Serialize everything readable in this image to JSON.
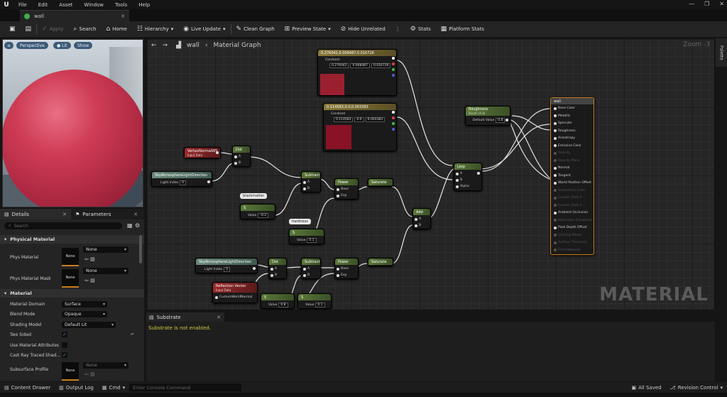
{
  "menu": {
    "items": [
      "File",
      "Edit",
      "Asset",
      "Window",
      "Tools",
      "Help"
    ]
  },
  "tab": {
    "title": "wall"
  },
  "toolbar": {
    "apply": "Apply",
    "search": "Search",
    "home": "Home",
    "hierarchy": "Hierarchy",
    "live_update": "Live Update",
    "clean_graph": "Clean Graph",
    "preview_state": "Preview State",
    "hide_unrelated": "Hide Unrelated",
    "stats": "Stats",
    "platform_stats": "Platform Stats"
  },
  "viewport": {
    "perspective": "Perspective",
    "lit": "Lit",
    "show": "Show"
  },
  "details": {
    "tabs": [
      "Details",
      "Parameters"
    ],
    "search_placeholder": "Search",
    "sections": {
      "physical": "Physical Material",
      "material": "Material"
    },
    "phys_material": {
      "label": "Phys Material",
      "thumb": "None",
      "value": "None"
    },
    "phys_mask": {
      "label": "Phys Material Mask",
      "thumb": "None",
      "value": "None"
    },
    "domain": {
      "label": "Material Domain",
      "value": "Surface"
    },
    "blend": {
      "label": "Blend Mode",
      "value": "Opaque"
    },
    "shading": {
      "label": "Shading Model",
      "value": "Default Lit"
    },
    "two_sided": {
      "label": "Two Sided"
    },
    "use_attr": {
      "label": "Use Material Attributes"
    },
    "cast_ray": {
      "label": "Cast Ray Traced Shad..."
    },
    "subsurface": {
      "label": "Subsurface Profile",
      "thumb": "None",
      "value": "None"
    }
  },
  "graph": {
    "breadcrumb_root": "wall",
    "breadcrumb": "Material Graph",
    "zoom": "Zoom -3",
    "watermark": "MATERIAL",
    "nodes": {
      "const1": {
        "title": "0.276042,0.008487,0.016726",
        "label": "Constant",
        "v": [
          "0.276042",
          "0.008487",
          "0.016726"
        ],
        "color": "#9a2030"
      },
      "const2": {
        "title": "0.114583,0.0,0.003383",
        "label": "Constant",
        "v": [
          "0.114583",
          "0.0",
          "0.003383"
        ],
        "color": "#8a1226"
      },
      "roughness": {
        "title": "Roughness",
        "sub": "Param (0.8)",
        "label": "Default Value",
        "v": "0.8"
      },
      "vertexnormal": {
        "title": "VertexNormalWS",
        "sub": "Input Data"
      },
      "dot1": {
        "title": "Dot",
        "a": "A",
        "b": "B"
      },
      "skylight1": {
        "title": "SkyAtmosphereLightDirection",
        "label": "Light Index",
        "v": "0"
      },
      "subtract1": {
        "title": "Subtract",
        "a": "A",
        "b": "B"
      },
      "power1": {
        "title": "Power",
        "a": "Base",
        "b": "Exp"
      },
      "saturate1": {
        "title": "Saturate"
      },
      "blackmatter": {
        "comment": "blackmatter",
        "label": "Value",
        "v": "-0.2"
      },
      "hardness": {
        "comment": "hardness",
        "label": "Value",
        "v": "0.1"
      },
      "add": {
        "title": "Add",
        "a": "A",
        "b": "B"
      },
      "lerp": {
        "title": "Lerp",
        "a": "A",
        "b": "B",
        "c": "Alpha"
      },
      "skylight2": {
        "title": "SkyAtmosphereLightDirection",
        "label": "Light Index",
        "v": "0"
      },
      "dot2": {
        "title": "Dot",
        "a": "A",
        "b": "B"
      },
      "subtract2": {
        "title": "Subtract",
        "a": "A",
        "b": "B"
      },
      "power2": {
        "title": "Power",
        "a": "Base",
        "b": "Exp"
      },
      "saturate2": {
        "title": "Saturate"
      },
      "reflection": {
        "title": "Reflection Vector",
        "sub": "Input Data",
        "pin": "CustomWorldNormal"
      },
      "val1": {
        "label": "Value",
        "v": "0.8"
      },
      "val2": {
        "label": "Value",
        "v": "0.1"
      },
      "output": {
        "title": "wall",
        "pins": [
          "Base Color",
          "Metallic",
          "Specular",
          "Roughness",
          "Anisotropy",
          "Emissive Color",
          "Opacity",
          "Opacity Mask",
          "Normal",
          "Tangent",
          "World Position Offset",
          "Subsurface Color",
          "Custom Data 0",
          "Custom Data 1",
          "Ambient Occlusion",
          "Refraction (Disabled)",
          "Pixel Depth Offset",
          "Shading Model",
          "Surface Thickness",
          "Front Material"
        ]
      }
    }
  },
  "substrate": {
    "tab": "Substrate",
    "message": "Substrate is not enabled."
  },
  "palette": "Palette",
  "status": {
    "content_drawer": "Content Drawer",
    "output_log": "Output Log",
    "cmd": "Cmd",
    "console_placeholder": "Enter Console Command",
    "all_saved": "All Saved",
    "revision": "Revision Control"
  }
}
